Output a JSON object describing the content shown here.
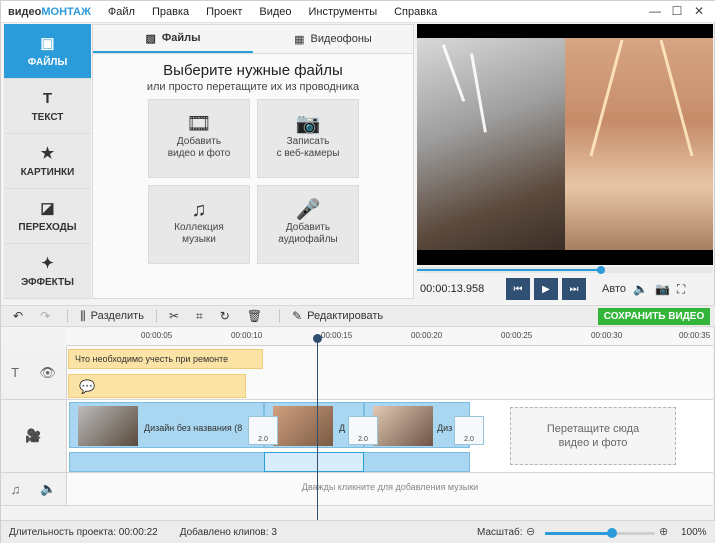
{
  "app": {
    "logo_a": "видео",
    "logo_b": "МОНТАЖ"
  },
  "menu": [
    "Файл",
    "Правка",
    "Проект",
    "Видео",
    "Инструменты",
    "Справка"
  ],
  "window_controls": [
    "—",
    "☐",
    "✕"
  ],
  "sidebar": [
    {
      "label": "ФАЙЛЫ",
      "icon": "image-icon",
      "glyph": "▣"
    },
    {
      "label": "ТЕКСТ",
      "icon": "text-icon",
      "glyph": "T"
    },
    {
      "label": "КАРТИНКИ",
      "icon": "star-icon",
      "glyph": "★"
    },
    {
      "label": "ПЕРЕХОДЫ",
      "icon": "transitions-icon",
      "glyph": "◪"
    },
    {
      "label": "ЭФФЕКТЫ",
      "icon": "magic-wand-icon",
      "glyph": "✦"
    }
  ],
  "panel": {
    "tabs": [
      {
        "label": "Файлы",
        "glyph": "▧"
      },
      {
        "label": "Видеофоны",
        "glyph": "▦"
      }
    ],
    "title": "Выберите нужные файлы",
    "subtitle": "или просто перетащите их из проводника",
    "tiles": [
      {
        "l1": "Добавить",
        "l2": "видео и фото",
        "glyph": "🎞"
      },
      {
        "l1": "Записать",
        "l2": "с веб-камеры",
        "glyph": "📷"
      },
      {
        "l1": "Коллекция",
        "l2": "музыки",
        "glyph": "♫"
      },
      {
        "l1": "Добавить",
        "l2": "аудиофайлы",
        "glyph": "🎤"
      }
    ]
  },
  "player": {
    "time": "00:00:13.958",
    "progress": 0.62,
    "auto_label": "Авто"
  },
  "toolbar": {
    "split": "Разделить",
    "edit": "Редактировать",
    "save": "СОХРАНИТЬ ВИДЕО"
  },
  "ruler": [
    "00:00:05",
    "00:00:10",
    "00:00:15",
    "00:00:20",
    "00:00:25",
    "00:00:30",
    "00:00:35"
  ],
  "tracks": {
    "text_clip": "Что необходимо учесть при ремонте",
    "video_clips": [
      "Дизайн без названия (8",
      "Д",
      "Диз"
    ],
    "transition_value": "2.0",
    "drop_l1": "Перетащите сюда",
    "drop_l2": "видео и фото",
    "music_hint": "Дважды кликните для добавления музыки"
  },
  "status": {
    "duration_label": "Длительность проекта:",
    "duration": "00:00:22",
    "clips_label": "Добавлено клипов:",
    "clips": "3",
    "zoom_label": "Масштаб:",
    "zoom_pct": "100%"
  },
  "colors": {
    "accent": "#2b9bd9",
    "save": "#33b539",
    "dark": "#2f4f73"
  }
}
